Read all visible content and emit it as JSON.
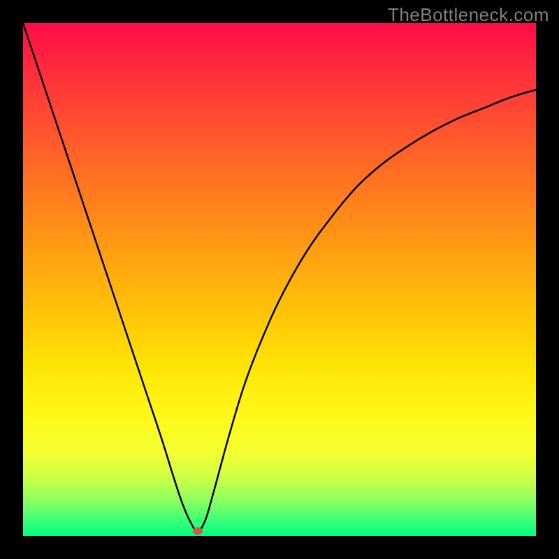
{
  "watermark": "TheBottleneck.com",
  "chart_data": {
    "type": "line",
    "title": "",
    "xlabel": "",
    "ylabel": "",
    "xlim": [
      0,
      100
    ],
    "ylim": [
      0,
      100
    ],
    "grid": false,
    "series": [
      {
        "name": "curve",
        "x": [
          0,
          3,
          6,
          9,
          12,
          15,
          18,
          21,
          24,
          27,
          29.5,
          31,
          32.5,
          34,
          35.5,
          37,
          40,
          43,
          46,
          50,
          55,
          60,
          65,
          70,
          75,
          80,
          85,
          90,
          95,
          100
        ],
        "y": [
          100,
          91,
          82,
          73,
          64,
          55,
          46,
          37,
          28,
          19,
          11,
          6.5,
          3,
          0.9,
          3,
          8,
          19,
          29,
          37,
          46,
          55,
          62,
          68,
          72.5,
          76,
          79,
          81.5,
          83.5,
          85.5,
          87
        ]
      }
    ],
    "marker": {
      "x": 34,
      "y": 0.9,
      "color": "#cf5a4b"
    },
    "background_gradient": {
      "type": "vertical",
      "stops": [
        {
          "pos": 0.0,
          "color": "#ff0b49"
        },
        {
          "pos": 0.5,
          "color": "#ffc808"
        },
        {
          "pos": 0.8,
          "color": "#fff91a"
        },
        {
          "pos": 1.0,
          "color": "#00ff84"
        }
      ]
    }
  }
}
